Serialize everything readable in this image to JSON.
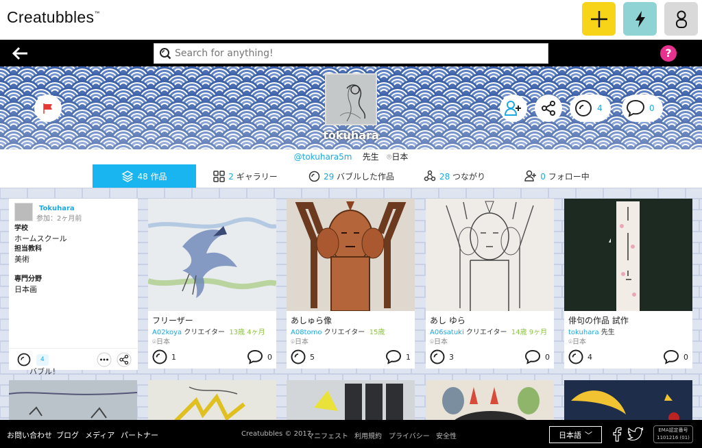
{
  "app": {
    "logo": "Creatubbles",
    "tm": "™"
  },
  "topbar": {
    "add_icon": "plus-icon",
    "activity_icon": "lightning-icon",
    "user_icon": "user-icon"
  },
  "colors": {
    "accent": "#19b5f0",
    "link": "#19a9e1",
    "add": "#f7d417",
    "activity": "#8fd3d4",
    "user": "#d9d9d9",
    "age": "#8cc63f",
    "help": "#e6328f"
  },
  "search": {
    "placeholder": "Search for anything!"
  },
  "help": {
    "label": "?"
  },
  "profile": {
    "name": "tokuhara",
    "handle": "@tokuhara5m",
    "role": "先生",
    "location": "日本",
    "bubble_count": "4",
    "comment_count": "0"
  },
  "tabs": [
    {
      "count": "48",
      "label": "作品"
    },
    {
      "count": "2",
      "label": "ギャラリー"
    },
    {
      "count": "29",
      "label": "バブルした作品"
    },
    {
      "count": "28",
      "label": "つながり"
    },
    {
      "count": "0",
      "label": "フォロー中"
    }
  ],
  "sidebar": {
    "name": "Tokuhara",
    "joined": "参加：2ヶ月前",
    "school_label": "学校",
    "school": "ホームスクール",
    "subject_label": "担当教科",
    "subject": "美術",
    "expertise_label": "専門分野",
    "expertise": "日本画",
    "bubble_count": "4",
    "bubble_label": "バブル！"
  },
  "cards": [
    {
      "title": "フリーザー",
      "user": "A02koya",
      "role": "クリエイター",
      "age": "13歳 4ヶ月",
      "location": "日本",
      "bubbles": "1",
      "comments": "0"
    },
    {
      "title": "あしゅら像",
      "user": "A08tomo",
      "role": "クリエイター",
      "age": "15歳",
      "location": "日本",
      "bubbles": "5",
      "comments": "1"
    },
    {
      "title": "あし ゆら",
      "user": "A06satuki",
      "role": "クリエイター",
      "age": "14歳 9ヶ月",
      "location": "日本",
      "bubbles": "3",
      "comments": "0"
    },
    {
      "title": "俳句の作品 試作",
      "user": "tokuhara",
      "role": "先生",
      "age": "",
      "location": "日本",
      "bubbles": "4",
      "comments": "0"
    }
  ],
  "footer": {
    "contact": "お問い合わせ",
    "blog": "ブログ",
    "media": "メディア",
    "partner": "パートナー",
    "copyright": "Creatubbles © 2017",
    "manifesto": "マニフェスト",
    "terms": "利用規約",
    "privacy": "プライバシー",
    "safety": "安全性",
    "language": "日本語",
    "ema_line1": "EMA認定番号",
    "ema_line2": "1101216 (01)"
  }
}
